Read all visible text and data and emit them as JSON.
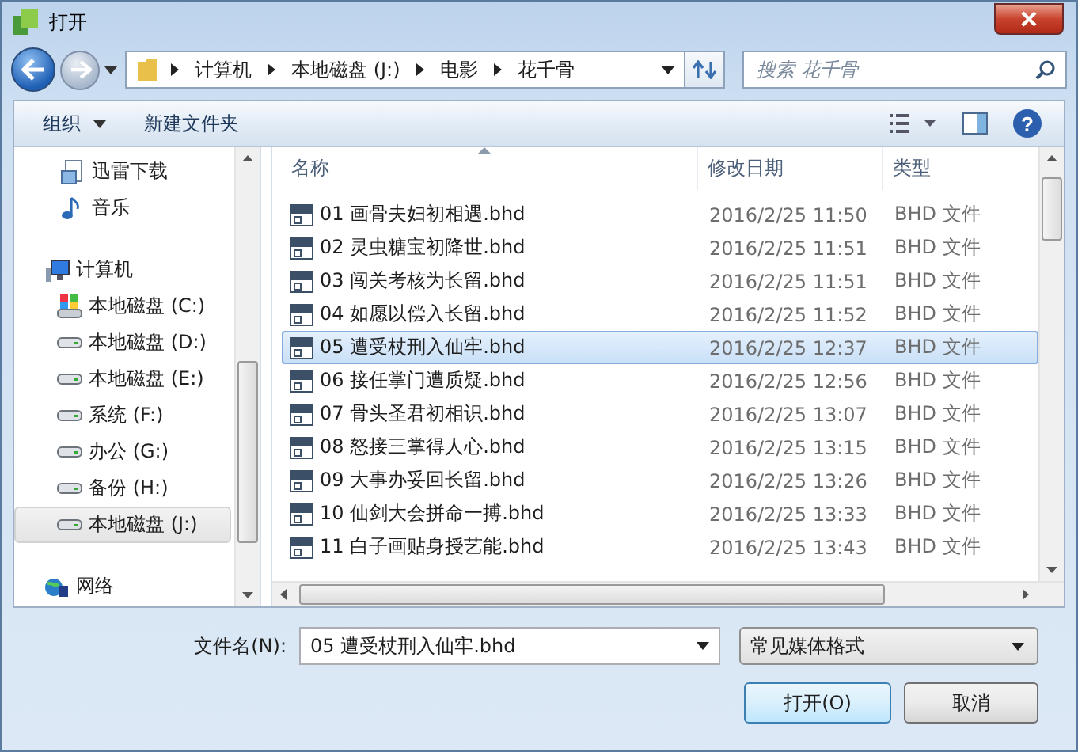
{
  "window": {
    "title": "打开"
  },
  "address_bar": {
    "breadcrumbs": [
      "计算机",
      "本地磁盘 (J:)",
      "电影",
      "花千骨"
    ]
  },
  "search": {
    "placeholder": "搜索 花千骨"
  },
  "toolbar": {
    "organize": "组织",
    "new_folder": "新建文件夹",
    "help": "?"
  },
  "sidebar": {
    "items": [
      {
        "label": "迅雷下载",
        "kind": "download",
        "selected": false
      },
      {
        "label": "音乐",
        "kind": "music",
        "selected": false
      },
      {
        "label": "计算机",
        "kind": "computer",
        "selected": false,
        "children": [
          {
            "label": "本地磁盘 (C:)",
            "kind": "system-drive",
            "selected": false
          },
          {
            "label": "本地磁盘 (D:)",
            "kind": "drive",
            "selected": false
          },
          {
            "label": "本地磁盘 (E:)",
            "kind": "drive",
            "selected": false
          },
          {
            "label": "系统 (F:)",
            "kind": "drive",
            "selected": false
          },
          {
            "label": "办公 (G:)",
            "kind": "drive",
            "selected": false
          },
          {
            "label": "备份 (H:)",
            "kind": "drive",
            "selected": false
          },
          {
            "label": "本地磁盘 (J:)",
            "kind": "drive",
            "selected": true
          }
        ]
      },
      {
        "label": "网络",
        "kind": "network",
        "selected": false
      }
    ]
  },
  "file_list": {
    "columns": [
      {
        "label": "名称",
        "sorted": true
      },
      {
        "label": "修改日期",
        "sorted": false
      },
      {
        "label": "类型",
        "sorted": false
      }
    ],
    "rows": [
      {
        "name": "01 画骨夫妇初相遇.bhd",
        "date": "2016/2/25 11:50",
        "type": "BHD 文件",
        "selected": false
      },
      {
        "name": "02 灵虫糖宝初降世.bhd",
        "date": "2016/2/25 11:51",
        "type": "BHD 文件",
        "selected": false
      },
      {
        "name": "03 闯关考核为长留.bhd",
        "date": "2016/2/25 11:51",
        "type": "BHD 文件",
        "selected": false
      },
      {
        "name": "04 如愿以偿入长留.bhd",
        "date": "2016/2/25 11:52",
        "type": "BHD 文件",
        "selected": false
      },
      {
        "name": "05 遭受杖刑入仙牢.bhd",
        "date": "2016/2/25 12:37",
        "type": "BHD 文件",
        "selected": true
      },
      {
        "name": "06 接任掌门遭质疑.bhd",
        "date": "2016/2/25 12:56",
        "type": "BHD 文件",
        "selected": false
      },
      {
        "name": "07 骨头圣君初相识.bhd",
        "date": "2016/2/25 13:07",
        "type": "BHD 文件",
        "selected": false
      },
      {
        "name": "08 怒接三掌得人心.bhd",
        "date": "2016/2/25 13:15",
        "type": "BHD 文件",
        "selected": false
      },
      {
        "name": "09 大事办妥回长留.bhd",
        "date": "2016/2/25 13:26",
        "type": "BHD 文件",
        "selected": false
      },
      {
        "name": "10 仙剑大会拼命一搏.bhd",
        "date": "2016/2/25 13:33",
        "type": "BHD 文件",
        "selected": false
      },
      {
        "name": "11 白子画贴身授艺能.bhd",
        "date": "2016/2/25 13:43",
        "type": "BHD 文件",
        "selected": false
      }
    ]
  },
  "file_name": {
    "label": "文件名(N):",
    "value": "05 遭受杖刑入仙牢.bhd"
  },
  "file_type": {
    "value": "常见媒体格式"
  },
  "buttons": [
    {
      "label": "打开(O)",
      "kind": "primary"
    },
    {
      "label": "取消",
      "kind": "secondary"
    }
  ]
}
